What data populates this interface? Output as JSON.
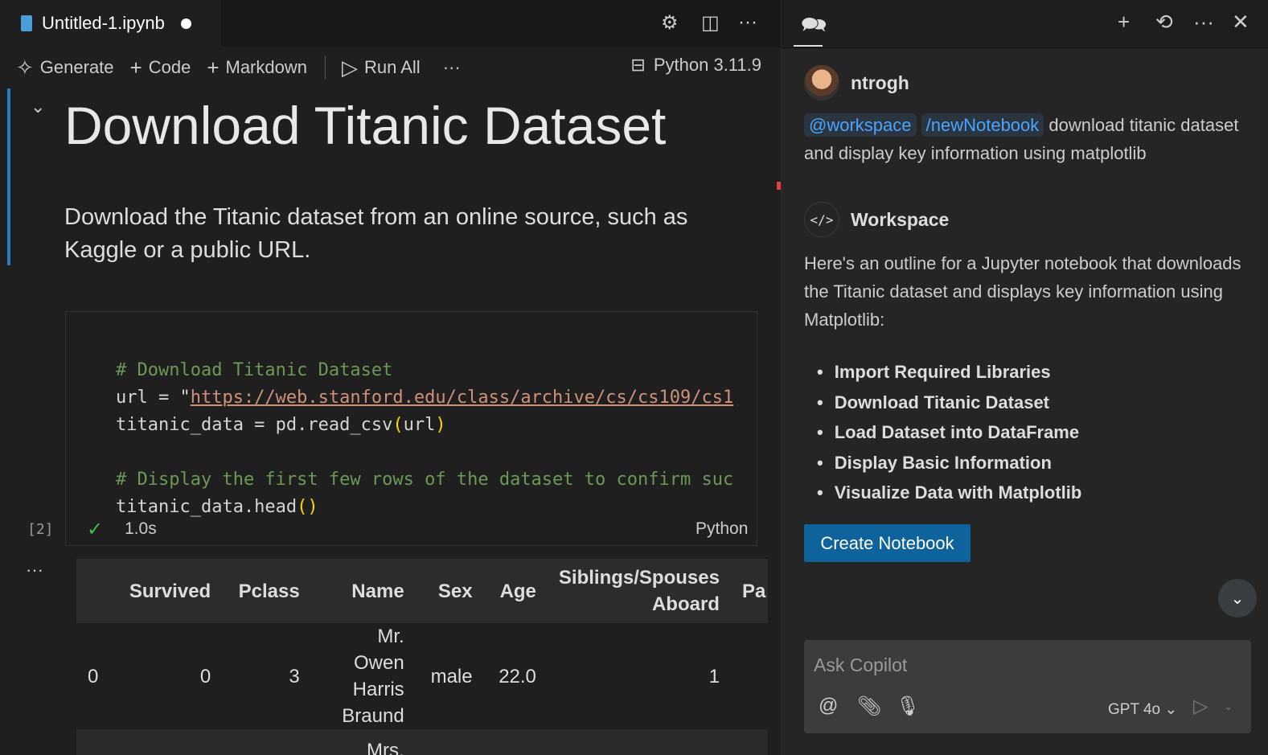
{
  "editor": {
    "tab_title": "Untitled-1.ipynb",
    "toolbar": {
      "generate": "Generate",
      "code": "Code",
      "markdown": "Markdown",
      "run_all": "Run All",
      "more": "···",
      "kernel": "Python 3.11.9"
    },
    "markdown": {
      "heading": "Download Titanic Dataset",
      "paragraph": "Download the Titanic dataset from an online source, such as Kaggle or a public URL."
    },
    "code_cell": {
      "lines": [
        {
          "comment": "# Download Titanic Dataset"
        },
        {
          "prefix": "url = \"",
          "string": "https://web.stanford.edu/class/archive/cs/cs109/cs1"
        },
        {
          "a": "titanic_data = pd.read_csv",
          "b": "(",
          "c": "url",
          "d": ")"
        },
        {
          "comment": "# Display the first few rows of the dataset to confirm suc"
        },
        {
          "a": "titanic_data.head",
          "b": "()"
        }
      ],
      "execution_count": "[2]",
      "duration": "1.0s",
      "language": "Python"
    },
    "output_table": {
      "headers": [
        "",
        "Survived",
        "Pclass",
        "Name",
        "Sex",
        "Age",
        "Siblings/Spouses Aboard",
        "Pa"
      ],
      "rows": [
        [
          "0",
          "0",
          "3",
          "Mr. Owen Harris Braund",
          "male",
          "22.0",
          "1",
          ""
        ],
        [
          "",
          "",
          "",
          "Mrs. John",
          "",
          "",
          "",
          ""
        ]
      ]
    }
  },
  "chat": {
    "user": {
      "name": "ntrogh",
      "chip_agent": "@workspace",
      "chip_command": "/newNotebook",
      "message": "download titanic dataset and display key information using matplotlib"
    },
    "response": {
      "agent": "Workspace",
      "intro": "Here's an outline for a Jupyter notebook that downloads the Titanic dataset and displays key information using Matplotlib:",
      "bullets": [
        "Import Required Libraries",
        "Download Titanic Dataset",
        "Load Dataset into DataFrame",
        "Display Basic Information",
        "Visualize Data with Matplotlib"
      ],
      "button": "Create Notebook"
    },
    "input": {
      "placeholder": "Ask Copilot",
      "model": "GPT 4o"
    }
  },
  "colors": {
    "accent": "#0e639c",
    "link": "#4aa3ff",
    "comment": "#6a9955",
    "string": "#ce9178"
  }
}
